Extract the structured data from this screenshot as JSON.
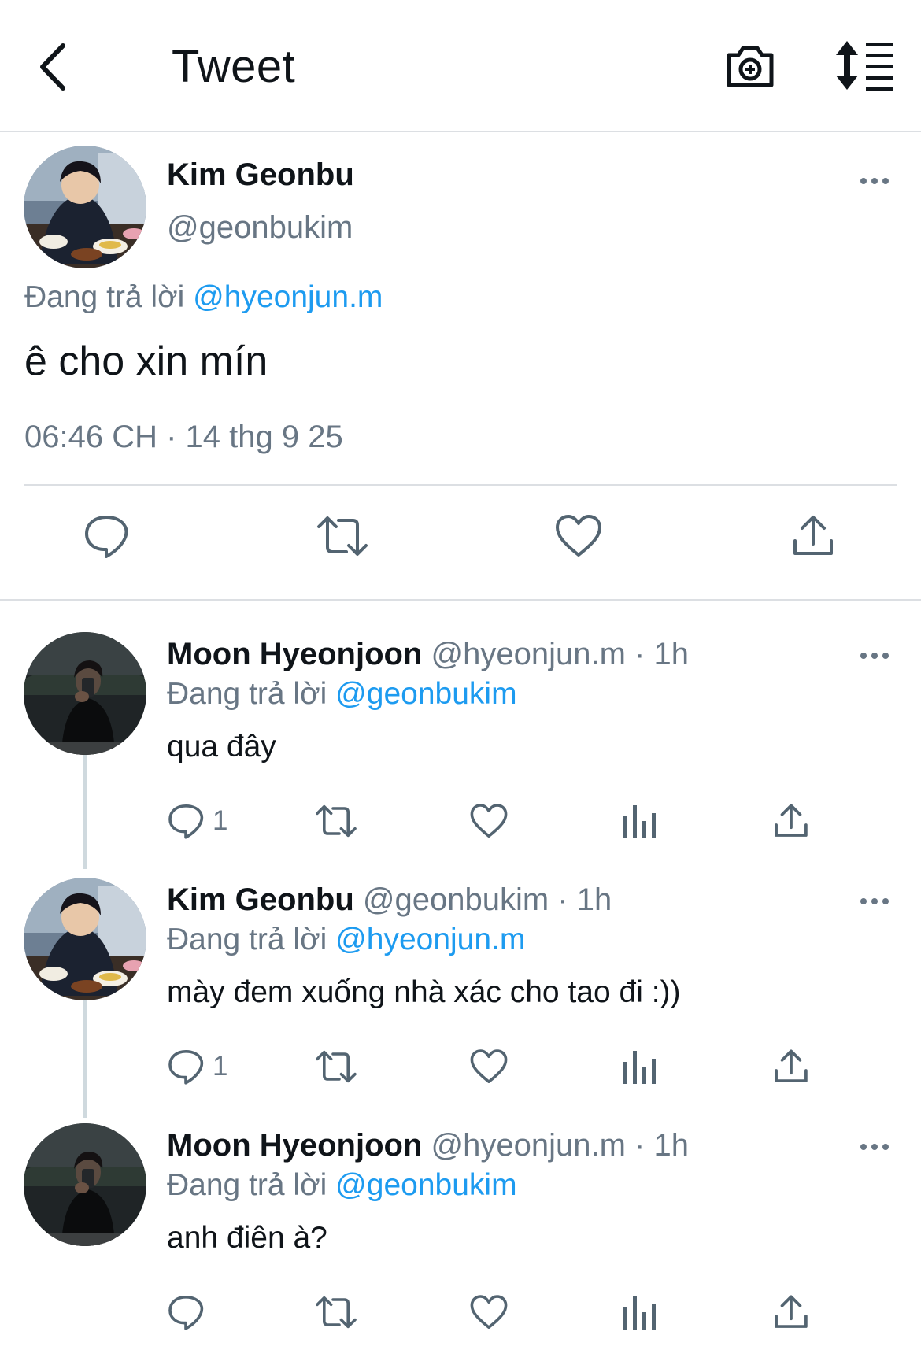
{
  "header": {
    "title": "Tweet"
  },
  "main_tweet": {
    "author_name": "Kim Geonbu",
    "author_handle": "@geonbukim",
    "replying_prefix": "Đang trả lời",
    "replying_to": "@hyeonjun.m",
    "text": "ê cho xin mín",
    "timestamp": "06:46 CH · 14 thg 9 25"
  },
  "replies": [
    {
      "author_name": "Moon Hyeonjoon",
      "meta": "@hyeonjun.m · 1h",
      "replying_prefix": "Đang trả lời",
      "replying_to": "@geonbukim",
      "text": "qua đây",
      "reply_count": "1"
    },
    {
      "author_name": "Kim Geonbu",
      "meta": "@geonbukim · 1h",
      "replying_prefix": "Đang trả lời",
      "replying_to": "@hyeonjun.m",
      "text": "mày đem xuống nhà xác cho tao đi :))",
      "reply_count": "1"
    },
    {
      "author_name": "Moon Hyeonjoon",
      "meta": "@hyeonjun.m · 1h",
      "replying_prefix": "Đang trả lời",
      "replying_to": "@geonbukim",
      "text": "anh điên à?",
      "reply_count": ""
    }
  ],
  "icons": {
    "back": "chevron-left-icon",
    "camera": "camera-plus-icon",
    "sort": "sort-replies-icon",
    "reply": "reply-bubble-icon",
    "retweet": "retweet-icon",
    "like": "heart-icon",
    "views": "views-bar-chart-icon",
    "share": "share-upload-icon",
    "more": "more-dots-icon"
  },
  "colors": {
    "link": "#1d9bf0",
    "secondary_text": "#687684",
    "icon": "#536471",
    "divider": "#dcdfe3"
  }
}
